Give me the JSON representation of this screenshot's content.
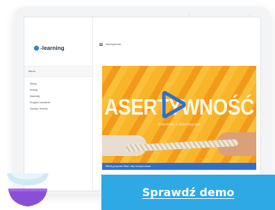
{
  "app": {
    "logo_text": "-learning"
  },
  "sidebar": {
    "section_title": "Menu",
    "items": [
      {
        "label": "Wstęp"
      },
      {
        "label": "Moduły"
      },
      {
        "label": "Materiały"
      },
      {
        "label": "Program szkolenia"
      },
      {
        "label": "Zasady i terminy"
      }
    ]
  },
  "content": {
    "header_title": "Asertywność"
  },
  "video": {
    "title": "ASERTYWNOŚĆ",
    "subtitle": "Szkolenie e-learningowe",
    "caption": "Kliknij przycisk Start, aby kontynuować"
  },
  "cta": {
    "label": "Sprawdź demo"
  },
  "colors": {
    "accent": "#2fa8e6",
    "video_bg": "#f6a81e",
    "play": "#2f6fd0",
    "bowl_top": "#cfeaf6",
    "bowl_bottom": "#8a4fd8"
  },
  "icons": {
    "play": "play-icon",
    "menu": "menu-icon",
    "logo": "logo-icon"
  }
}
